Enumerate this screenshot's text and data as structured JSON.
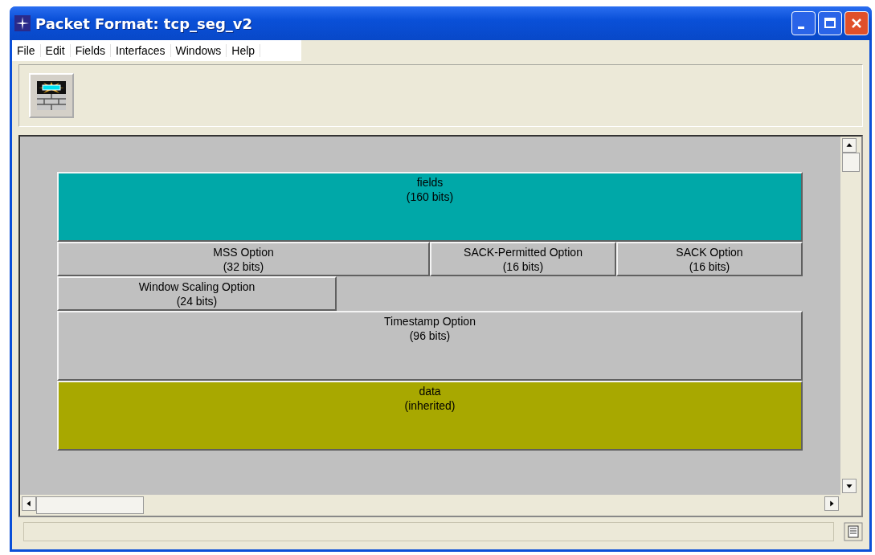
{
  "window": {
    "title": "Packet Format: tcp_seg_v2"
  },
  "menu": [
    "File",
    "Edit",
    "Fields",
    "Interfaces",
    "Windows",
    "Help"
  ],
  "blocks": [
    {
      "name": "fields",
      "size": "(160 bits)",
      "color": "#00a8a8"
    },
    {
      "name": "MSS Option",
      "size": "(32 bits)",
      "color": "#c0c0c0"
    },
    {
      "name": "SACK-Permitted Option",
      "size": "(16 bits)",
      "color": "#c0c0c0"
    },
    {
      "name": "SACK Option",
      "size": "(16 bits)",
      "color": "#c0c0c0"
    },
    {
      "name": "Window Scaling Option",
      "size": "(24 bits)",
      "color": "#c0c0c0"
    },
    {
      "name": "Timestamp Option",
      "size": "(96 bits)",
      "color": "#c0c0c0"
    },
    {
      "name": "data",
      "size": "(inherited)",
      "color": "#a8a800"
    }
  ]
}
